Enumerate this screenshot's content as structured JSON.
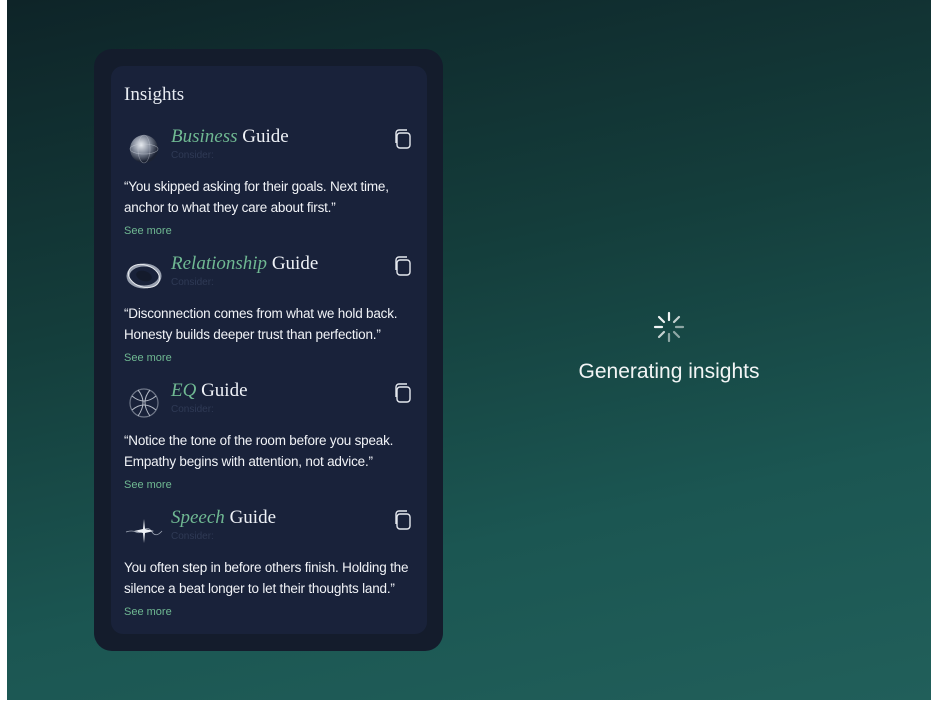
{
  "panel": {
    "title": "Insights"
  },
  "guides": [
    {
      "accent": "Business",
      "suffix": " Guide",
      "subtitle": "Consider:",
      "quote": "“You skipped asking for their goals. Next time, anchor to what they care about first.”",
      "see_more": "See more",
      "icon": "sphere-icon"
    },
    {
      "accent": "Relationship",
      "suffix": " Guide",
      "subtitle": "Consider:",
      "quote": "“Disconnection comes from what we hold back. Honesty builds deeper trust than perfection.”",
      "see_more": "See more",
      "icon": "ring-icon"
    },
    {
      "accent": "EQ",
      "suffix": " Guide",
      "subtitle": "Consider:",
      "quote": "“Notice the tone of the room before you speak. Empathy begins with attention, not advice.”",
      "see_more": "See more",
      "icon": "knot-icon"
    },
    {
      "accent": "Speech",
      "suffix": " Guide",
      "subtitle": "Consider:",
      "quote": "You often step in before others finish. Holding the silence a beat longer to let their thoughts land.”",
      "see_more": "See more",
      "icon": "sparkle-wave-icon"
    }
  ],
  "status": {
    "text": "Generating insights",
    "icon": "spinner-icon"
  },
  "colors": {
    "accent": "#6fb892",
    "panel_outer": "#141c2c",
    "panel_inner": "#19223a"
  }
}
